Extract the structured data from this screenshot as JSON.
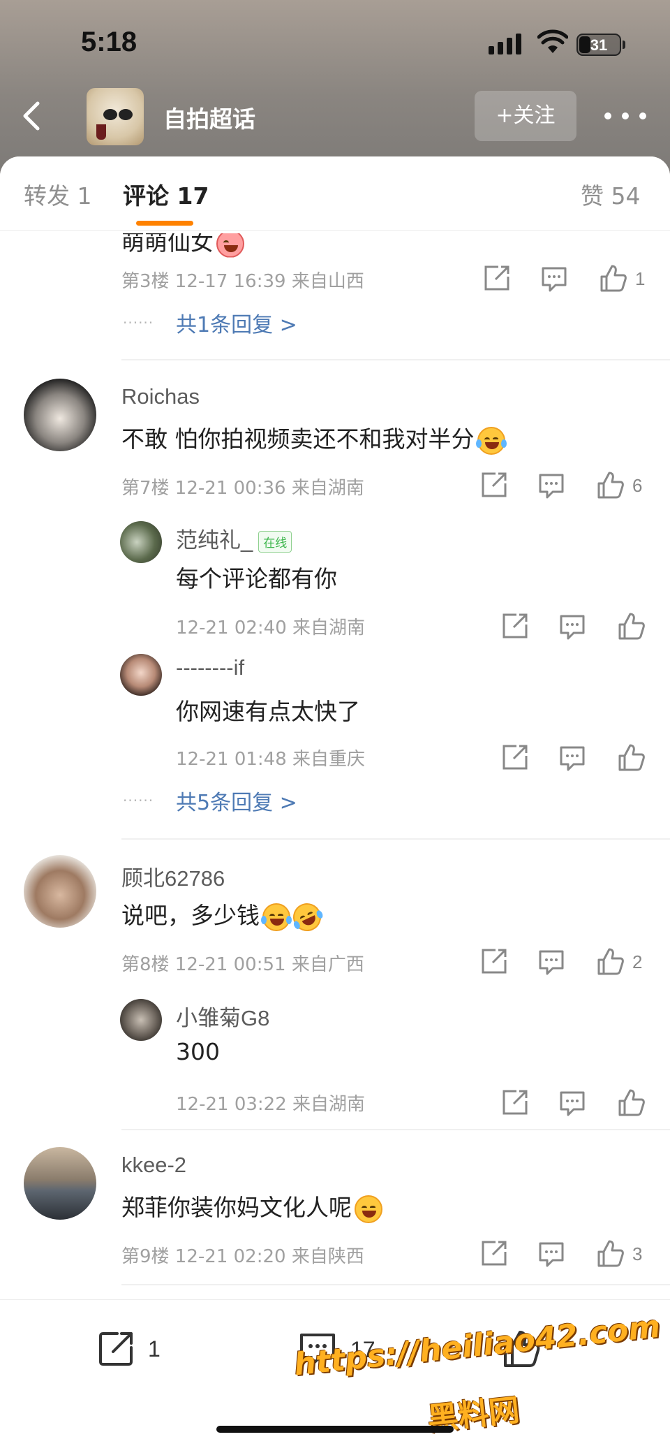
{
  "status_bar": {
    "time": "5:18",
    "battery": "31"
  },
  "nav": {
    "title": "自拍超话",
    "follow_label": "+关注"
  },
  "tabs": [
    {
      "label": "转发 1"
    },
    {
      "label": "评论 17"
    },
    {
      "label": "赞 54"
    }
  ],
  "comments": [
    {
      "text": "萌萌仙女",
      "meta": "第3楼  12-17 16:39  来自山西",
      "likes": "1",
      "more_replies": "共1条回复 >"
    },
    {
      "user": "Roichas",
      "text": "不敢 怕你拍视频卖还不和我对半分",
      "meta": "第7楼  12-21 00:36  来自湖南",
      "likes": "6",
      "replies": [
        {
          "user": "范纯礼_",
          "badge": "在线",
          "text": "每个评论都有你",
          "meta": "12-21 02:40  来自湖南"
        },
        {
          "user": "--------if",
          "text": "你网速有点太快了",
          "meta": "12-21 01:48  来自重庆"
        }
      ],
      "more_replies": "共5条回复 >"
    },
    {
      "user": "顾北62786",
      "text": "说吧，多少钱",
      "meta": "第8楼  12-21 00:51  来自广西",
      "likes": "2",
      "replies": [
        {
          "user": "小雏菊G8",
          "text": "300",
          "meta": "12-21 03:22  来自湖南"
        }
      ]
    },
    {
      "user": "kkee-2",
      "text": "郑菲你装你妈文化人呢",
      "meta": "第9楼  12-21 02:20  来自陕西",
      "likes": "3"
    }
  ],
  "bottom_bar": {
    "repost_count": "1",
    "comment_count": "17"
  },
  "watermark": {
    "line1": "https://heiliao42.com",
    "line2": "黑料网"
  },
  "colors": {
    "accent": "#ff8200",
    "link": "#4e7ab4",
    "online": "#3bb54a"
  }
}
